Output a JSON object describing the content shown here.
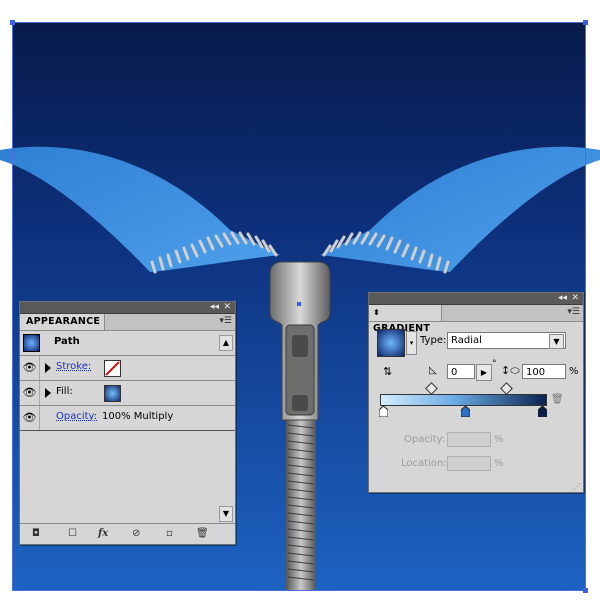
{
  "artwork": {
    "bg_dark": "#0a2466",
    "bg_light": "#1c67c6",
    "fabric": "#3f8fe0",
    "selection_color": "#3a61e0"
  },
  "appearance_panel": {
    "tab_label": "APPEARANCE",
    "collapse_icon": "double-chevron-left-icon",
    "close_icon": "close-icon",
    "menu_icon": "panel-menu-icon",
    "path_label": "Path",
    "stroke_label": "Stroke:",
    "fill_label": "Fill:",
    "opacity_label": "Opacity:",
    "opacity_value": "100% Multiply",
    "bottom_icons": [
      "add-new-stroke-icon",
      "add-new-fill-icon",
      "fx-icon",
      "clear-appearance-icon",
      "duplicate-item-icon",
      "delete-item-icon"
    ],
    "fx_label": "fx"
  },
  "gradient_panel": {
    "tab_label": "GRADIENT",
    "type_label": "Type:",
    "type_value": "Radial",
    "angle_value": "0",
    "aspect_value": "100",
    "percent_sign": "%",
    "degree_sign": "°",
    "opacity_label": "Opacity:",
    "location_label": "Location:",
    "stop_colors": [
      "#ffffff",
      "#1e5aa8",
      "#0b1f4a"
    ],
    "stop_locations_percent": [
      0,
      50,
      100
    ]
  }
}
